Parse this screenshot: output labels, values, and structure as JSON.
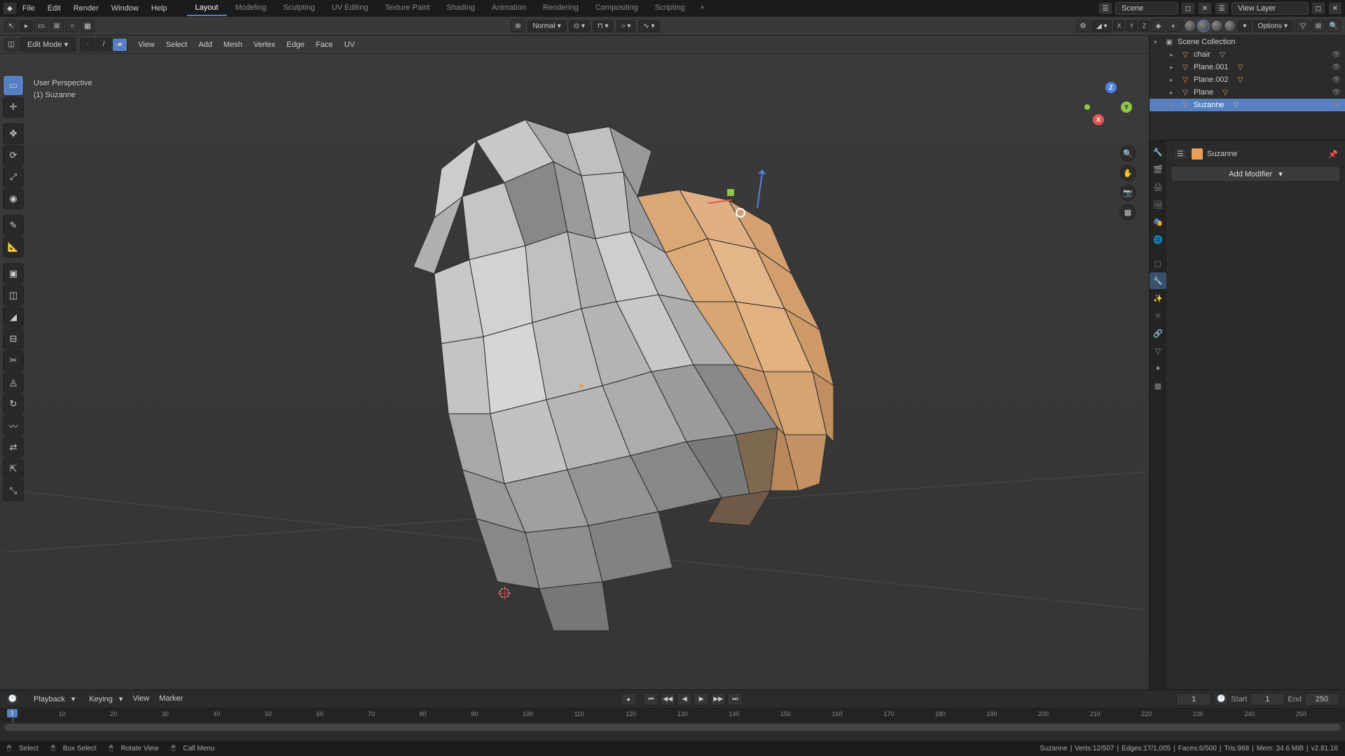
{
  "topbar": {
    "menus": [
      "File",
      "Edit",
      "Render",
      "Window",
      "Help"
    ],
    "workspaces": [
      "Layout",
      "Modeling",
      "Sculpting",
      "UV Editing",
      "Texture Paint",
      "Shading",
      "Animation",
      "Rendering",
      "Compositing",
      "Scripting"
    ],
    "active_workspace": "Layout",
    "scene_label": "Scene",
    "view_layer_label": "View Layer"
  },
  "header2": {
    "transform_orientation": "Normal",
    "options_label": "Options"
  },
  "viewport": {
    "mode": "Edit Mode",
    "menus": [
      "View",
      "Select",
      "Add",
      "Mesh",
      "Vertex",
      "Edge",
      "Face",
      "UV"
    ],
    "info_line1": "User Perspective",
    "info_line2": "(1) Suzanne",
    "nav_axes": {
      "x": "X",
      "y": "Y",
      "z": "Z"
    }
  },
  "outliner": {
    "root": "Scene Collection",
    "items": [
      {
        "name": "chair",
        "selected": false
      },
      {
        "name": "Plane.001",
        "selected": false
      },
      {
        "name": "Plane.002",
        "selected": false
      },
      {
        "name": "Plane",
        "selected": false
      },
      {
        "name": "Suzanne",
        "selected": true
      }
    ]
  },
  "properties": {
    "object_name": "Suzanne",
    "add_modifier_label": "Add Modifier"
  },
  "timeline": {
    "menus": [
      "Playback",
      "Keying",
      "View",
      "Marker"
    ],
    "current_frame": "1",
    "start_label": "Start",
    "start_value": "1",
    "end_label": "End",
    "end_value": "250",
    "ruler_ticks": [
      1,
      10,
      20,
      30,
      40,
      50,
      60,
      70,
      80,
      90,
      100,
      110,
      120,
      130,
      140,
      150,
      160,
      170,
      180,
      190,
      200,
      210,
      220,
      230,
      240,
      250
    ]
  },
  "statusbar": {
    "select_label": "Select",
    "box_select_label": "Box Select",
    "rotate_view_label": "Rotate View",
    "call_menu_label": "Call Menu",
    "object": "Suzanne",
    "verts": "Verts:12/507",
    "edges": "Edges:17/1,005",
    "faces": "Faces:6/500",
    "tris": "Tris:968",
    "mem": "Mem: 34.6 MiB",
    "version": "v2.81.16"
  }
}
